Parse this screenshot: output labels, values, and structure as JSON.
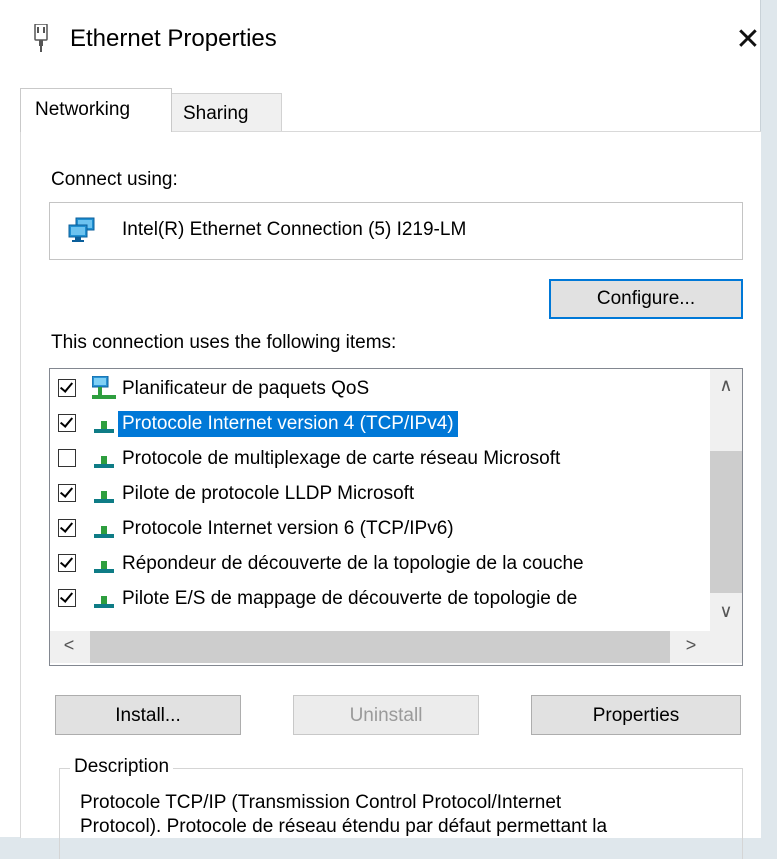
{
  "window": {
    "title": "Ethernet Properties",
    "close_glyph": "✕"
  },
  "tabs": [
    {
      "label": "Networking",
      "active": true
    },
    {
      "label": "Sharing",
      "active": false
    }
  ],
  "connect": {
    "label": "Connect using:",
    "adapter": "Intel(R) Ethernet Connection (5) I219-LM",
    "adapter_icon": "network-adapter-icon",
    "configure_button": "Configure..."
  },
  "items": {
    "label": "This connection uses the following items:",
    "list": [
      {
        "text": "Planificateur de paquets QoS",
        "checked": true,
        "icon": "qos-scheduler-icon",
        "selected": false
      },
      {
        "text": "Protocole Internet version 4 (TCP/IPv4)",
        "checked": true,
        "icon": "protocol-icon",
        "selected": true
      },
      {
        "text": "Protocole de multiplexage de carte réseau Microsoft",
        "checked": false,
        "icon": "protocol-icon",
        "selected": false
      },
      {
        "text": "Pilote de protocole LLDP Microsoft",
        "checked": true,
        "icon": "protocol-icon",
        "selected": false
      },
      {
        "text": "Protocole Internet version 6 (TCP/IPv6)",
        "checked": true,
        "icon": "protocol-icon",
        "selected": false
      },
      {
        "text": "Répondeur de découverte de la topologie de la couche",
        "checked": true,
        "icon": "protocol-icon",
        "selected": false
      },
      {
        "text": "Pilote E/S de mappage de découverte de topologie de",
        "checked": true,
        "icon": "protocol-icon",
        "selected": false
      }
    ]
  },
  "buttons": {
    "install": "Install...",
    "uninstall": "Uninstall",
    "properties": "Properties"
  },
  "description": {
    "legend": "Description",
    "line1": "Protocole TCP/IP (Transmission Control Protocol/Internet",
    "line2": "Protocol). Protocole de réseau étendu par défaut permettant la"
  },
  "colors": {
    "selection": "#0078d7",
    "protocol_icon_green": "#2e9e3e",
    "protocol_icon_teal": "#0e7c86"
  }
}
